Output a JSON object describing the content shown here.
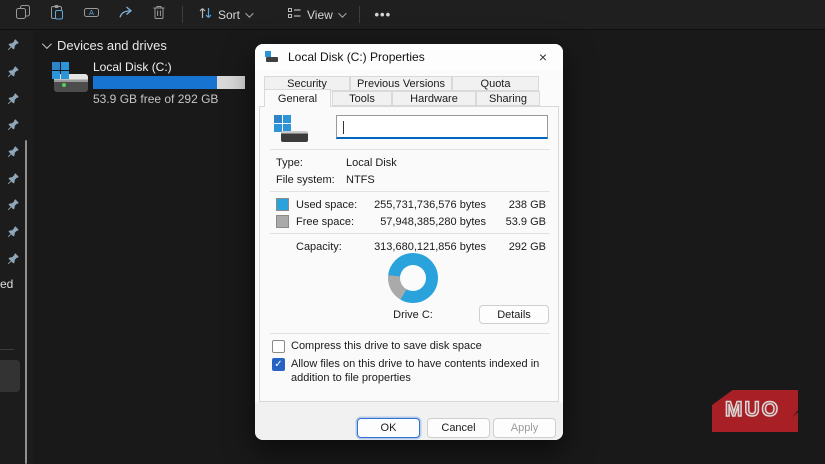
{
  "toolbar": {
    "sort_label": "Sort",
    "view_label": "View",
    "more_label": "•••",
    "icons": [
      "copy",
      "paste",
      "rename",
      "share",
      "delete",
      "sort-arrows",
      "view-list",
      "more-dots"
    ]
  },
  "sidebar": {
    "pinned_icon": "pushpin",
    "truncated_label": "ed"
  },
  "explorer": {
    "section_header": "Devices and drives",
    "drive": {
      "name": "Local Disk (C:)",
      "free_text": "53.9 GB free of 292 GB",
      "bar_fill_pct": 81.5
    }
  },
  "dialog": {
    "title": "Local Disk (C:) Properties",
    "close_glyph": "×",
    "tabs_back": [
      "Security",
      "Previous Versions",
      "Quota"
    ],
    "tabs_front": [
      "General",
      "Tools",
      "Hardware",
      "Sharing"
    ],
    "active_tab": "General",
    "general": {
      "label_value": "",
      "type_label": "Type:",
      "type_value": "Local Disk",
      "fs_label": "File system:",
      "fs_value": "NTFS",
      "used_label": "Used space:",
      "used_bytes": "255,731,736,576 bytes",
      "used_size": "238 GB",
      "free_label": "Free space:",
      "free_bytes": "57,948,385,280 bytes",
      "free_size": "53.9 GB",
      "capacity_label": "Capacity:",
      "capacity_bytes": "313,680,121,856 bytes",
      "capacity_size": "292 GB",
      "drive_label": "Drive C:",
      "details_button": "Details",
      "compress_label": "Compress this drive to save disk space",
      "compress_checked": false,
      "index_label": "Allow files on this drive to have contents indexed in addition to file properties",
      "index_checked": true,
      "check_glyph": "✓",
      "donut": {
        "used_pct": 81.5,
        "free_pct": 18.5,
        "free_start_deg": 210
      }
    },
    "buttons": {
      "ok": "OK",
      "cancel": "Cancel",
      "apply": "Apply"
    },
    "colors": {
      "used": "#2aa3dc",
      "free": "#aaaaaa",
      "accent": "#2563c4",
      "bar_fill": "#1874d1"
    }
  },
  "watermark": {
    "text": "MUO",
    "color": "#a82025"
  }
}
